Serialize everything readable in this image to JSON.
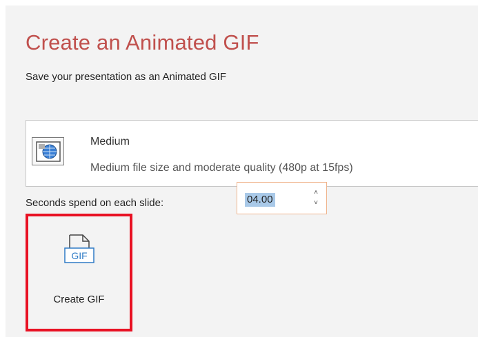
{
  "page": {
    "title": "Create an Animated GIF",
    "subtitle": "Save your presentation as an Animated GIF"
  },
  "quality": {
    "name": "Medium",
    "description": "Medium file size and moderate quality (480p at 15fps)",
    "icon": "quality-monitor-icon"
  },
  "seconds": {
    "label": "Seconds spend on each slide:",
    "value": "04.00",
    "up_icon": "chevron-up-icon",
    "down_icon": "chevron-down-icon"
  },
  "create_button": {
    "label": "Create GIF",
    "icon_text": "GIF",
    "icon": "gif-file-icon"
  },
  "colors": {
    "title": "#c0504d",
    "highlight_border": "#e81123",
    "selection": "#a9c9e8",
    "stepper_border": "#f0b48c",
    "panel": "#f3f3f3"
  }
}
